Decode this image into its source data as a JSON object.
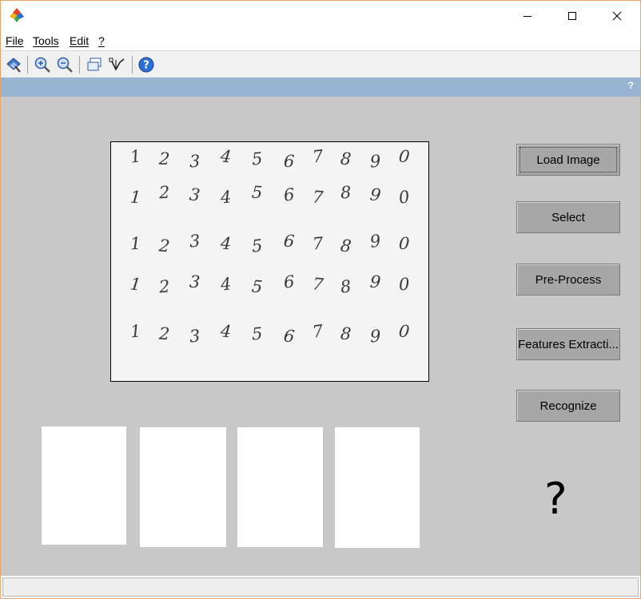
{
  "window": {
    "controls": [
      "minimize",
      "maximize",
      "close"
    ]
  },
  "menubar": {
    "items": [
      {
        "label": "File"
      },
      {
        "label": "Tools"
      },
      {
        "label": "Edit"
      },
      {
        "label": "?"
      }
    ]
  },
  "toolbar": {
    "icons": [
      "edit-plot-icon",
      "zoom-in-icon",
      "zoom-out-icon",
      "new-figure-icon",
      "data-cursor-icon",
      "help-icon"
    ]
  },
  "bluebar": {
    "help_label": "?"
  },
  "image_panel": {
    "rows": [
      [
        "1",
        "2",
        "3",
        "4",
        "5",
        "6",
        "7",
        "8",
        "9",
        "0"
      ],
      [
        "1",
        "2",
        "3",
        "4",
        "5",
        "6",
        "7",
        "8",
        "9",
        "0"
      ],
      [
        "1",
        "2",
        "3",
        "4",
        "5",
        "6",
        "7",
        "8",
        "9",
        "0"
      ],
      [
        "1",
        "2",
        "3",
        "4",
        "5",
        "6",
        "7",
        "8",
        "9",
        "0"
      ],
      [
        "1",
        "2",
        "3",
        "4",
        "5",
        "6",
        "7",
        "8",
        "9",
        "0"
      ]
    ]
  },
  "buttons": {
    "load_image": "Load Image",
    "select": "Select",
    "pre_process": "Pre-Process",
    "features_extraction": "Features Extracti...",
    "recognize": "Recognize"
  },
  "result": {
    "text": "?"
  },
  "colors": {
    "main_background": "#c8c8c8",
    "blue_strip": "#99b4d1",
    "button_face": "#a6a6a6",
    "window_border": "#e8a36a"
  }
}
